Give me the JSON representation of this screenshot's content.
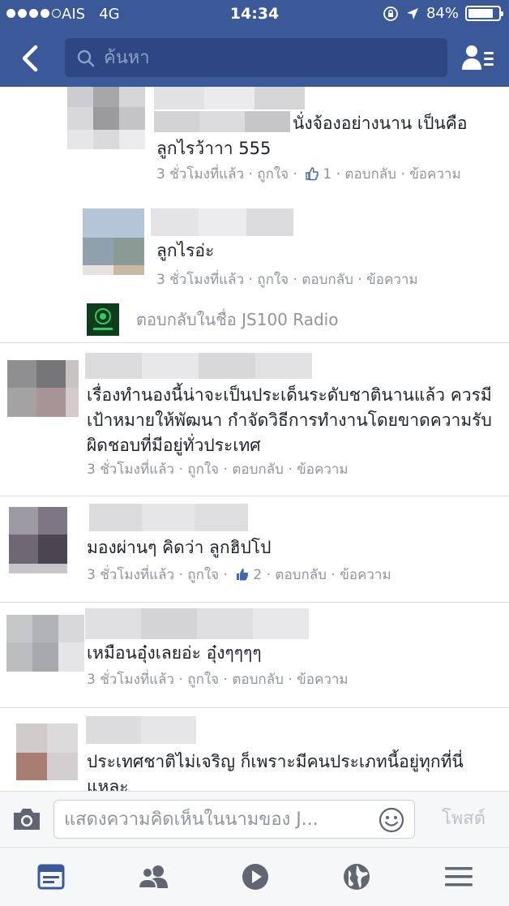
{
  "status": {
    "carrier": "AIS",
    "network": "4G",
    "time": "14:34",
    "battery": "84%",
    "battery_level": 0.84
  },
  "search": {
    "placeholder": "ค้นหา"
  },
  "comments": [
    {
      "type": "reply",
      "text": "นั่งจ้องอย่างนาน เป็นคือ ลูกไรว้าาา 555",
      "time": "3 ชั่วโมงที่แล้ว",
      "like": "ถูกใจ",
      "likes": "1",
      "reply": "ตอบกลับ",
      "message": "ข้อความ"
    },
    {
      "type": "reply",
      "text": "ลูกไรอ่ะ",
      "time": "3 ชั่วโมงที่แล้ว",
      "like": "ถูกใจ",
      "reply": "ตอบกลับ",
      "message": "ข้อความ"
    },
    {
      "type": "comment",
      "text": "เรื่องทำนองนี้น่าจะเป็นประเด็นระดับชาตินานแล้ว ควรมีเป้าหมายให้พัฒนา กำจัดวิธีการทำงานโดยขาดความรับผิดชอบที่มีอยู่ทั่วประเทศ",
      "time": "3 ชั่วโมงที่แล้ว",
      "like": "ถูกใจ",
      "reply": "ตอบกลับ",
      "message": "ข้อความ"
    },
    {
      "type": "comment",
      "text": "มองผ่านๆ คิดว่า ลูกฮิปโป",
      "time": "3 ชั่วโมงที่แล้ว",
      "like": "ถูกใจ",
      "likes": "2",
      "reply": "ตอบกลับ",
      "message": "ข้อความ"
    },
    {
      "type": "comment",
      "text": "เหมือนอุ๋งเลยอ่ะ อุ๋งๆๆๆๆ",
      "time": "3 ชั่วโมงที่แล้ว",
      "like": "ถูกใจ",
      "reply": "ตอบกลับ",
      "message": "ข้อความ"
    },
    {
      "type": "comment",
      "text": "ประเทศชาติไม่เจริญ ก็เพราะมีคนประเภทนี้อยู่ทุกที่นี่แหละ"
    }
  ],
  "reply_as": "ตอบกลับในชื่อ JS100 Radio",
  "composer": {
    "placeholder": "แสดงความคิดเห็นในนามของ J...",
    "post_label": "โพสต์"
  },
  "tabs": [
    "news-feed",
    "friends",
    "watch",
    "notifications",
    "menu"
  ],
  "colors": {
    "brand": "#3b5998",
    "meta_text": "#90949c",
    "like_blue": "#4267b2"
  }
}
